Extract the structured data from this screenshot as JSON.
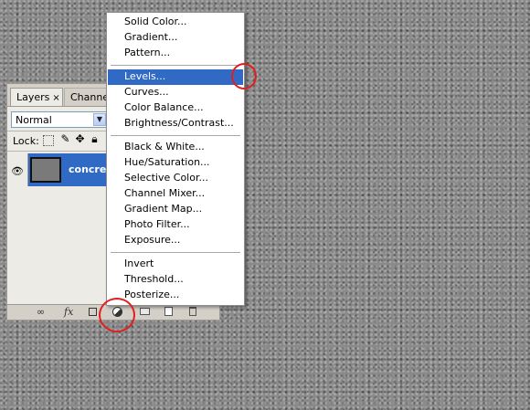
{
  "layers_panel": {
    "tabs": [
      {
        "label": "Layers",
        "close": "×"
      },
      {
        "label": "Channels"
      }
    ],
    "blend_mode": "Normal",
    "lock_label": "Lock:",
    "layer": {
      "name": "concrete"
    }
  },
  "menu": {
    "groups": [
      [
        "Solid Color...",
        "Gradient...",
        "Pattern..."
      ],
      [
        "Levels...",
        "Curves...",
        "Color Balance...",
        "Brightness/Contrast..."
      ],
      [
        "Black & White...",
        "Hue/Saturation...",
        "Selective Color...",
        "Channel Mixer...",
        "Gradient Map...",
        "Photo Filter...",
        "Exposure..."
      ],
      [
        "Invert",
        "Threshold...",
        "Posterize..."
      ]
    ],
    "selected": "Levels..."
  },
  "colors": {
    "selection": "#316ac5",
    "annotation": "#e21e1e"
  },
  "icons": [
    "visibility-eye-icon",
    "link-icon",
    "fx-icon",
    "mask-icon",
    "adjustment-layer-icon",
    "group-folder-icon",
    "new-layer-icon",
    "trash-icon"
  ]
}
